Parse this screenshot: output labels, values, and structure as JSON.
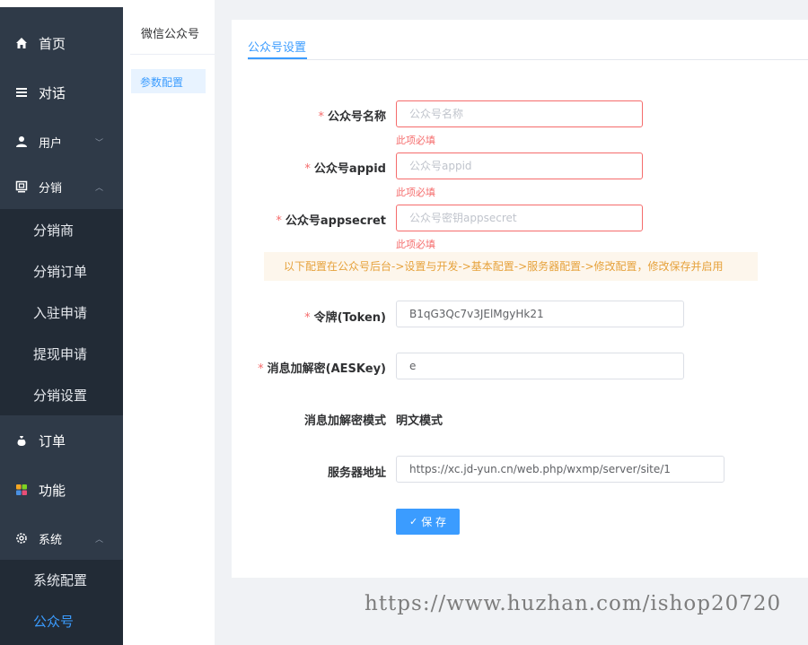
{
  "sidebar": {
    "items": [
      {
        "label": "首页",
        "icon": "home-icon"
      },
      {
        "label": "对话",
        "icon": "menu-icon"
      },
      {
        "label": "用户",
        "icon": "user-icon"
      },
      {
        "label": "分销",
        "icon": "monitor-icon"
      },
      {
        "label": "订单",
        "icon": "bag-icon"
      },
      {
        "label": "功能",
        "icon": "grid-icon"
      },
      {
        "label": "系统",
        "icon": "gear-icon"
      }
    ],
    "distribution_sub": [
      "分销商",
      "分销订单",
      "入驻申请",
      "提现申请",
      "分销设置"
    ],
    "system_sub": [
      "系统配置",
      "公众号"
    ]
  },
  "submenu": {
    "title": "微信公众号",
    "active_item": "参数配置"
  },
  "main": {
    "tab": "公众号设置",
    "fields": {
      "name": {
        "label": "公众号名称",
        "placeholder": "公众号名称",
        "error": "此项必填"
      },
      "appid": {
        "label": "公众号appid",
        "placeholder": "公众号appid",
        "error": "此项必填"
      },
      "appsecret": {
        "label": "公众号appsecret",
        "placeholder": "公众号密钥appsecret",
        "error": "此项必填"
      }
    },
    "notice": "以下配置在公众号后台->设置与开发->基本配置->服务器配置->修改配置，修改保存并启用",
    "token": {
      "label": "令牌(Token)",
      "value": "B1qG3Qc7v3JElMgyHk21"
    },
    "aeskey": {
      "label": "消息加解密(AESKey)",
      "value": "e"
    },
    "encrypt_mode": {
      "label": "消息加解密模式",
      "value": "明文模式"
    },
    "server_url": {
      "label": "服务器地址",
      "value": "https://xc.jd-yun.cn/web.php/wxmp/server/site/1"
    },
    "save_label": "保 存"
  },
  "watermark": "https://www.huzhan.com/ishop20720",
  "colors": {
    "accent": "#3b9cff",
    "sidebar": "#2f3a48",
    "error": "#f56c6c",
    "warning": "#e6a23c"
  }
}
